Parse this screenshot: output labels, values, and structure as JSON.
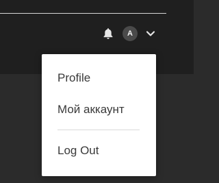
{
  "header": {
    "avatar_initial": "A",
    "icons": {
      "notifications": "bell-icon",
      "menu_toggle": "chevron-down-icon"
    }
  },
  "user_menu": {
    "items": [
      {
        "label": "Profile"
      },
      {
        "label": "Мой аккаунт"
      },
      {
        "label": "Log Out"
      }
    ]
  },
  "colors": {
    "header_background": "#1f1f1f",
    "page_background": "#2b2b2b",
    "menu_background": "#ffffff",
    "menu_text": "#3a3a3a",
    "icon_color": "#e6e6e6"
  }
}
